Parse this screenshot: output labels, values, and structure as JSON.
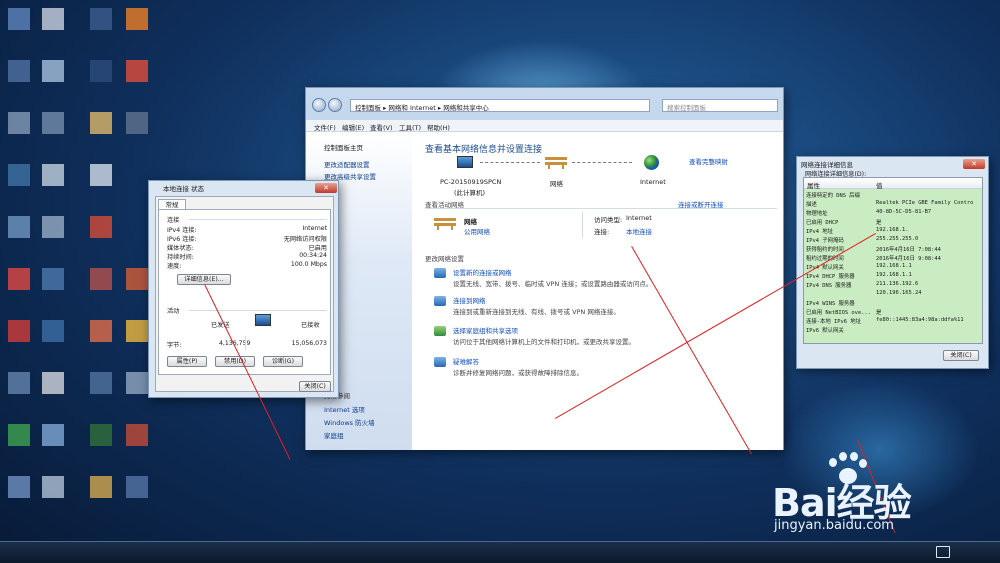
{
  "main_window": {
    "address_path": [
      "控制面板",
      "网络和 Internet",
      "网络和共享中心"
    ],
    "search_placeholder": "搜索控制面板",
    "menu": [
      "文件(F)",
      "编辑(E)",
      "查看(V)",
      "工具(T)",
      "帮助(H)"
    ],
    "sidebar_top": [
      "控制面板主页",
      "更改适配器设置",
      "更改高级共享设置"
    ],
    "sidebar_bottom": [
      "Internet 选项",
      "Windows 防火墙",
      "家庭组"
    ],
    "sidebar_see_also": "另请参阅",
    "heading": "查看基本网络信息并设置连接",
    "view_full_map": "查看完整映射",
    "map_nodes": [
      {
        "label": "PC-20150919SPCN",
        "sub": "(此计算机)"
      },
      {
        "label": "网络"
      },
      {
        "label": "Internet"
      }
    ],
    "active_networks_label": "查看活动网络",
    "connect_or_disconnect": "连接或断开连接",
    "network_name": "网络",
    "network_type": "公用网络",
    "access_type_label": "访问类型:",
    "access_type_value": "Internet",
    "connections_label": "连接:",
    "connections_value": "本地连接",
    "change_settings_label": "更改网络设置",
    "tasks": [
      {
        "title": "设置新的连接或网络",
        "desc": "设置无线、宽带、拨号、临时或 VPN 连接；或设置路由器或访问点。"
      },
      {
        "title": "连接到网络",
        "desc": "连接到或重新连接到无线、有线、拨号或 VPN 网络连接。"
      },
      {
        "title": "选择家庭组和共享选项",
        "desc": "访问位于其他网络计算机上的文件和打印机，或更改共享设置。"
      },
      {
        "title": "疑难解答",
        "desc": "诊断并修复网络问题，或获得故障排除信息。"
      }
    ]
  },
  "status_dialog": {
    "title": "本地连接 状态",
    "tab": "常规",
    "connection_section": "连接",
    "rows": [
      {
        "label": "IPv4 连接:",
        "value": "Internet"
      },
      {
        "label": "IPv6 连接:",
        "value": "无网络访问权限"
      },
      {
        "label": "媒体状态:",
        "value": "已启用"
      },
      {
        "label": "持续时间:",
        "value": "00:34:24"
      },
      {
        "label": "速度:",
        "value": "100.0 Mbps"
      }
    ],
    "details_button": "详细信息(E)...",
    "activity_section": "活动",
    "sent_label": "已发送",
    "received_label": "已接收",
    "bytes_label": "字节:",
    "bytes_sent": "4,136,759",
    "bytes_received": "15,056,073",
    "properties_button": "属性(P)",
    "disable_button": "禁用(D)",
    "diagnose_button": "诊断(G)",
    "close_button": "关闭(C)"
  },
  "details_dialog": {
    "title": "网络连接详细信息",
    "caption": "网络连接详细信息(D):",
    "col_property": "属性",
    "col_value": "值",
    "rows": [
      {
        "k": "连接特定的 DNS 后缀",
        "v": ""
      },
      {
        "k": "描述",
        "v": "Realtek PCIe GBE Family Contro"
      },
      {
        "k": "物理地址",
        "v": "40-8D-5C-D5-81-B7"
      },
      {
        "k": "已启用 DHCP",
        "v": "是"
      },
      {
        "k": "IPv4 地址",
        "v": "192.168.1."
      },
      {
        "k": "IPv4 子网掩码",
        "v": "255.255.255.0"
      },
      {
        "k": "获得租约的时间",
        "v": "2016年4月16日 7:08:44"
      },
      {
        "k": "租约过期的时间",
        "v": "2016年4月16日 9:08:44"
      },
      {
        "k": "IPv4 默认网关",
        "v": "192.168.1.1"
      },
      {
        "k": "IPv4 DHCP 服务器",
        "v": "192.168.1.1"
      },
      {
        "k": "IPv4 DNS 服务器",
        "v": "211.136.192.6"
      },
      {
        "k": "",
        "v": "120.196.165.24"
      },
      {
        "k": "IPv4 WINS 服务器",
        "v": ""
      },
      {
        "k": "已启用 NetBIOS ove...",
        "v": "是"
      },
      {
        "k": "连接-本地 IPv6 地址",
        "v": "fe80::1445:83a4:98a:ddfa%11"
      },
      {
        "k": "IPv6 默认网关",
        "v": ""
      }
    ],
    "close_button": "关闭(C)"
  },
  "watermark": {
    "logo": "Bai经验",
    "url": "jingyan.baidu.com"
  },
  "colors": {
    "link": "#0f4cc2",
    "heading": "#1e4e8f",
    "annotation": "#e02020",
    "details_bg": "#c9ecc2"
  }
}
